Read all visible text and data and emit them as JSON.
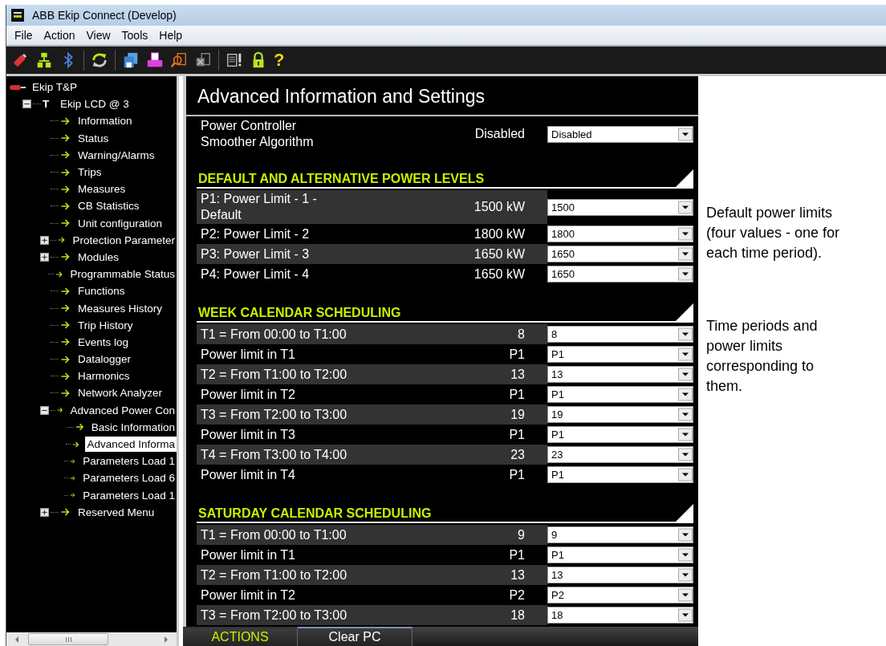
{
  "window": {
    "title": "ABB Ekip Connect (Develop)"
  },
  "menu": [
    "File",
    "Action",
    "View",
    "Tools",
    "Help"
  ],
  "toolbar": {
    "help_glyph": "?"
  },
  "tree": [
    {
      "label": "Ekip T&P",
      "kind": "device",
      "selected": false,
      "children": [
        {
          "label": "Ekip LCD @ 3",
          "kind": "unit",
          "glyph": "T",
          "expanded": true,
          "selected": false,
          "children": [
            {
              "label": "Information",
              "kind": "page",
              "selected": false
            },
            {
              "label": "Status",
              "kind": "page",
              "selected": false
            },
            {
              "label": "Warning/Alarms",
              "kind": "page",
              "selected": false
            },
            {
              "label": "Trips",
              "kind": "page",
              "selected": false
            },
            {
              "label": "Measures",
              "kind": "page",
              "selected": false
            },
            {
              "label": "CB Statistics",
              "kind": "page",
              "selected": false
            },
            {
              "label": "Unit configuration",
              "kind": "page",
              "selected": false
            },
            {
              "label": "Protection Parameter",
              "kind": "page",
              "expanded": false,
              "selected": false
            },
            {
              "label": "Modules",
              "kind": "page",
              "expanded": false,
              "selected": false
            },
            {
              "label": "Programmable Status",
              "kind": "page",
              "selected": false
            },
            {
              "label": "Functions",
              "kind": "page",
              "selected": false
            },
            {
              "label": "Measures History",
              "kind": "page",
              "selected": false
            },
            {
              "label": "Trip History",
              "kind": "page",
              "selected": false
            },
            {
              "label": "Events log",
              "kind": "page",
              "selected": false
            },
            {
              "label": "Datalogger",
              "kind": "page",
              "selected": false
            },
            {
              "label": "Harmonics",
              "kind": "page",
              "selected": false
            },
            {
              "label": "Network Analyzer",
              "kind": "page",
              "selected": false
            },
            {
              "label": "Advanced Power Con",
              "kind": "page",
              "expanded": true,
              "selected": false,
              "children": [
                {
                  "label": "Basic Information",
                  "kind": "page",
                  "selected": false
                },
                {
                  "label": "Advanced Informa",
                  "kind": "page",
                  "selected": true
                },
                {
                  "label": "Parameters Load 1",
                  "kind": "page",
                  "selected": false
                },
                {
                  "label": "Parameters Load 6",
                  "kind": "page",
                  "selected": false
                },
                {
                  "label": "Parameters Load 1",
                  "kind": "page",
                  "selected": false
                }
              ]
            },
            {
              "label": "Reserved Menu",
              "kind": "page",
              "expanded": false,
              "selected": false
            }
          ]
        }
      ]
    }
  ],
  "panel_title": "Advanced Information and Settings",
  "settings": [
    {
      "label": "Power Controller\nSmoother Algorithm",
      "reading": "Disabled",
      "value": "Disabled"
    }
  ],
  "sections": [
    {
      "title": "DEFAULT AND ALTERNATIVE POWER LEVELS",
      "rows": [
        {
          "label": "P1: Power Limit - 1 -\nDefault",
          "reading": "1500 kW",
          "value": "1500"
        },
        {
          "label": "P2: Power Limit - 2",
          "reading": "1800 kW",
          "value": "1800"
        },
        {
          "label": "P3: Power Limit - 3",
          "reading": "1650 kW",
          "value": "1650"
        },
        {
          "label": "P4: Power Limit - 4",
          "reading": "1650 kW",
          "value": "1650"
        }
      ]
    },
    {
      "title": "WEEK CALENDAR SCHEDULING",
      "rows": [
        {
          "label": "T1 = From 00:00 to T1:00",
          "reading": "8",
          "value": "8"
        },
        {
          "label": "Power limit in T1",
          "reading": "P1",
          "value": "P1"
        },
        {
          "label": "T2 = From T1:00 to T2:00",
          "reading": "13",
          "value": "13"
        },
        {
          "label": "Power limit in T2",
          "reading": "P1",
          "value": "P1"
        },
        {
          "label": "T3 = From T2:00 to T3:00",
          "reading": "19",
          "value": "19"
        },
        {
          "label": "Power limit in T3",
          "reading": "P1",
          "value": "P1"
        },
        {
          "label": "T4 = From T3:00 to T4:00",
          "reading": "23",
          "value": "23"
        },
        {
          "label": "Power limit in T4",
          "reading": "P1",
          "value": "P1"
        }
      ]
    },
    {
      "title": "SATURDAY CALENDAR SCHEDULING",
      "rows": [
        {
          "label": "T1 = From 00:00 to T1:00",
          "reading": "9",
          "value": "9"
        },
        {
          "label": "Power limit in T1",
          "reading": "P1",
          "value": "P1"
        },
        {
          "label": "T2 = From T1:00 to T2:00",
          "reading": "13",
          "value": "13"
        },
        {
          "label": "Power limit in T2",
          "reading": "P2",
          "value": "P2"
        },
        {
          "label": "T3 = From T2:00 to T3:00",
          "reading": "18",
          "value": "18"
        }
      ]
    }
  ],
  "bottom_tabs": [
    {
      "label": "ACTIONS",
      "selected": true
    },
    {
      "label": "Clear PC",
      "selected": false
    }
  ],
  "annotations": [
    "Default power limits\n(four values - one for\neach time period).",
    "Time periods and\npower limits\ncorresponding to\nthem."
  ]
}
